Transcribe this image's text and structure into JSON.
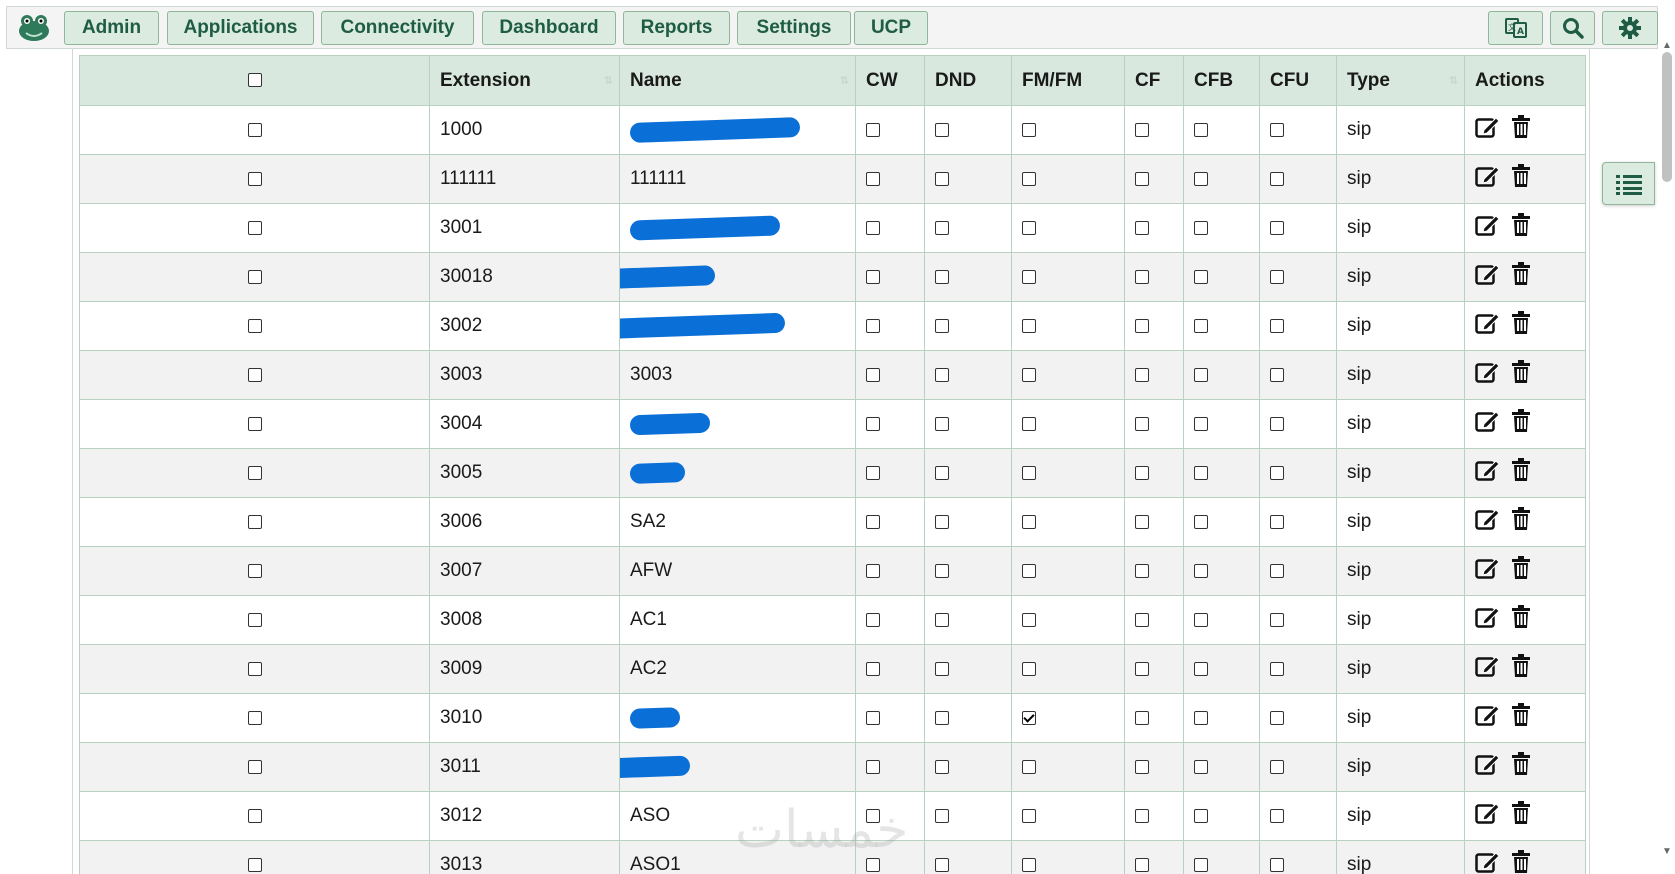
{
  "nav": {
    "buttons": [
      "Admin",
      "Applications",
      "Connectivity",
      "Dashboard",
      "Reports",
      "Settings",
      "UCP"
    ],
    "icons": [
      "translate-icon",
      "search-icon",
      "gear-icon"
    ]
  },
  "table": {
    "headers": {
      "extension": "Extension",
      "name": "Name",
      "cw": "CW",
      "dnd": "DND",
      "fmfm": "FM/FM",
      "cf": "CF",
      "cfb": "CFB",
      "cfu": "CFU",
      "type": "Type",
      "actions": "Actions"
    },
    "rows": [
      {
        "extension": "1000",
        "name": "",
        "redacted": true,
        "cw": false,
        "dnd": false,
        "fmfm": false,
        "cf": false,
        "cfb": false,
        "cfu": false,
        "type": "sip"
      },
      {
        "extension": "111111",
        "name": "111111",
        "redacted": false,
        "cw": false,
        "dnd": false,
        "fmfm": false,
        "cf": false,
        "cfb": false,
        "cfu": false,
        "type": "sip"
      },
      {
        "extension": "3001",
        "name": "",
        "redacted": true,
        "cw": false,
        "dnd": false,
        "fmfm": false,
        "cf": false,
        "cfb": false,
        "cfu": false,
        "type": "sip"
      },
      {
        "extension": "30018",
        "name": "",
        "redacted": true,
        "cw": false,
        "dnd": false,
        "fmfm": false,
        "cf": false,
        "cfb": false,
        "cfu": false,
        "type": "sip"
      },
      {
        "extension": "3002",
        "name": "",
        "redacted": true,
        "cw": false,
        "dnd": false,
        "fmfm": false,
        "cf": false,
        "cfb": false,
        "cfu": false,
        "type": "sip"
      },
      {
        "extension": "3003",
        "name": "3003",
        "redacted": false,
        "cw": false,
        "dnd": false,
        "fmfm": false,
        "cf": false,
        "cfb": false,
        "cfu": false,
        "type": "sip"
      },
      {
        "extension": "3004",
        "name": "",
        "redacted": true,
        "cw": false,
        "dnd": false,
        "fmfm": false,
        "cf": false,
        "cfb": false,
        "cfu": false,
        "type": "sip"
      },
      {
        "extension": "3005",
        "name": "",
        "redacted": true,
        "cw": false,
        "dnd": false,
        "fmfm": false,
        "cf": false,
        "cfb": false,
        "cfu": false,
        "type": "sip"
      },
      {
        "extension": "3006",
        "name": "SA2",
        "redacted": false,
        "cw": false,
        "dnd": false,
        "fmfm": false,
        "cf": false,
        "cfb": false,
        "cfu": false,
        "type": "sip"
      },
      {
        "extension": "3007",
        "name": "AFW",
        "redacted": false,
        "cw": false,
        "dnd": false,
        "fmfm": false,
        "cf": false,
        "cfb": false,
        "cfu": false,
        "type": "sip"
      },
      {
        "extension": "3008",
        "name": "AC1",
        "redacted": false,
        "cw": false,
        "dnd": false,
        "fmfm": false,
        "cf": false,
        "cfb": false,
        "cfu": false,
        "type": "sip"
      },
      {
        "extension": "3009",
        "name": "AC2",
        "redacted": false,
        "cw": false,
        "dnd": false,
        "fmfm": false,
        "cf": false,
        "cfb": false,
        "cfu": false,
        "type": "sip"
      },
      {
        "extension": "3010",
        "name": "",
        "redacted": true,
        "cw": false,
        "dnd": false,
        "fmfm": true,
        "cf": false,
        "cfb": false,
        "cfu": false,
        "type": "sip"
      },
      {
        "extension": "3011",
        "name": "",
        "redacted": true,
        "cw": false,
        "dnd": false,
        "fmfm": false,
        "cf": false,
        "cfb": false,
        "cfu": false,
        "type": "sip"
      },
      {
        "extension": "3012",
        "name": "ASO",
        "redacted": false,
        "cw": false,
        "dnd": false,
        "fmfm": false,
        "cf": false,
        "cfb": false,
        "cfu": false,
        "type": "sip"
      },
      {
        "extension": "3013",
        "name": "ASO1",
        "redacted": false,
        "cw": false,
        "dnd": false,
        "fmfm": false,
        "cf": false,
        "cfb": false,
        "cfu": false,
        "type": "sip"
      }
    ]
  },
  "colors": {
    "accent": "#1f5c45",
    "header_bg": "#d8e8de",
    "redaction": "#0a6fd6"
  }
}
